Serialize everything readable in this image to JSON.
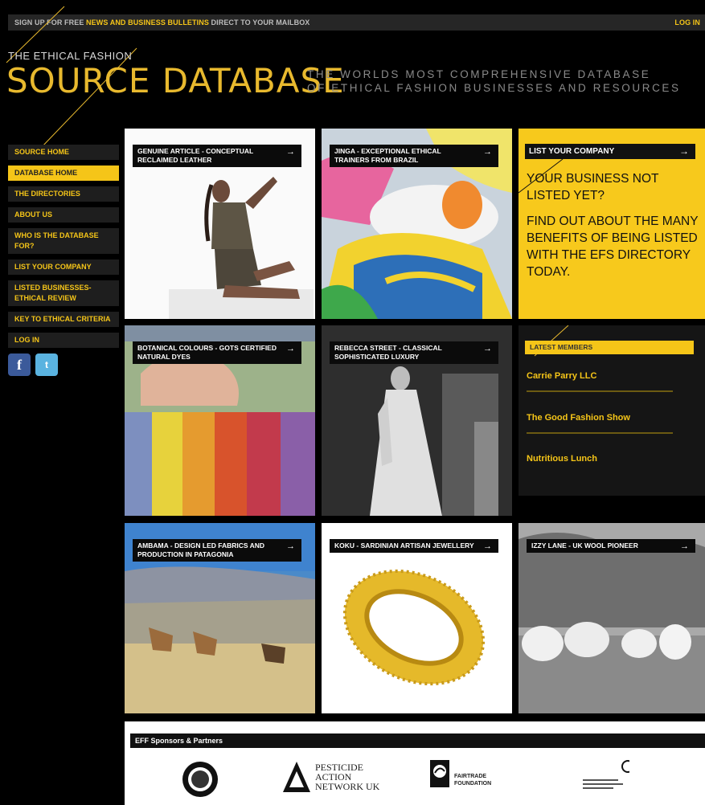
{
  "topbar": {
    "signup_prefix": "SIGN UP FOR FREE ",
    "signup_highlight": "NEWS AND BUSINESS BULLETINS",
    "signup_suffix": " DIRECT TO YOUR MAILBOX",
    "login": "LOG IN"
  },
  "logo": {
    "small": "THE ETHICAL FASHION",
    "big": "SOURCE DATABASE",
    "tagline_1": "THE WORLDS MOST COMPREHENSIVE DATABASE",
    "tagline_2": "OF ETHICAL FASHION BUSINESSES AND RESOURCES"
  },
  "sidebar": {
    "items": [
      {
        "label": "SOURCE HOME"
      },
      {
        "label": "DATABASE HOME"
      },
      {
        "label": "THE DIRECTORIES"
      },
      {
        "label": "ABOUT US"
      },
      {
        "label": "WHO IS THE DATABASE FOR?"
      },
      {
        "label": "LIST YOUR COMPANY"
      },
      {
        "label": "LISTED BUSINESSES- ETHICAL REVIEW"
      },
      {
        "label": "KEY TO ETHICAL CRITERIA"
      },
      {
        "label": "LOG IN"
      }
    ],
    "facebook_icon": "facebook-icon",
    "twitter_icon": "twitter-icon"
  },
  "tiles": {
    "t1": "GENUINE ARTICLE - CONCEPTUAL RECLAIMED LEATHER",
    "t2": "JINGA - EXCEPTIONAL ETHICAL TRAINERS FROM BRAZIL",
    "t3": "BOTANICAL COLOURS - GOTS CERTIFIED NATURAL DYES",
    "t4": "REBECCA STREET - CLASSICAL SOPHISTICATED LUXURY",
    "t5": "AMBAMA - DESIGN LED FABRICS AND PRODUCTION IN PATAGONIA",
    "t6": "KOKU - SARDINIAN ARTISAN JEWELLERY",
    "t7": "IZZY LANE - UK WOOL PIONEER",
    "arrow": "→"
  },
  "promo": {
    "bar": "LIST YOUR COMPANY",
    "line1": "YOUR BUSINESS NOT LISTED YET?",
    "line2": "FIND OUT ABOUT THE MANY BENEFITS OF BEING LISTED WITH THE EFS DIRECTORY TODAY."
  },
  "latest": {
    "heading": "LATEST MEMBERS",
    "members": [
      {
        "name": "Carrie Parry LLC"
      },
      {
        "name": "The Good Fashion Show"
      },
      {
        "name": "Nutritious Lunch"
      }
    ]
  },
  "sponsors": {
    "heading": "EFF Sponsors & Partners",
    "pan_1": "PESTICIDE",
    "pan_2": "ACTION",
    "pan_3": "NETWORK UK",
    "fairtrade_1": "FAIRTRADE",
    "fairtrade_2": "FOUNDATION"
  },
  "colors": {
    "accent": "#f5c518",
    "background": "#000000"
  }
}
